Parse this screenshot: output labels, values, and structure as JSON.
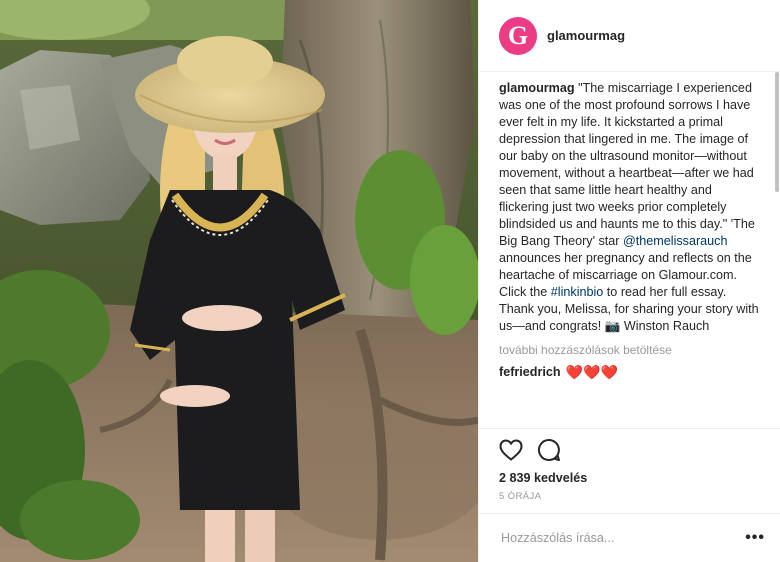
{
  "post": {
    "image_alt": "Pregnant woman in straw hat and black embroidered dress in a forest",
    "author": {
      "avatar_letter": "G",
      "username": "glamourmag"
    },
    "caption": {
      "username": "glamourmag",
      "text_1": "\"The miscarriage I experienced was one of the most profound sorrows I have ever felt in my life. It kickstarted a primal depression that lingered in me. The image of our baby on the ultrasound monitor—without movement, without a heartbeat—after we had seen that same little heart healthy and flickering just two weeks prior completely blindsided us and haunts me to this day.\" 'The Big Bang Theory' star ",
      "mention": "@themelissarauch",
      "text_2": " announces her pregnancy and reflects on the heartache of miscarriage on Glamour.com. Click the ",
      "hashtag": "#linkinbio",
      "text_3": " to read her full essay. Thank you, Melissa, for sharing your story with us—and congrats! 📷 Winston Rauch"
    },
    "load_more_label": "további hozzászólások betöltése",
    "comments": [
      {
        "username": "fefriedrich",
        "text": "❤️❤️❤️"
      }
    ],
    "likes_label": "2 839 kedvelés",
    "time_label": "5 ÓRÁJA",
    "add_comment_placeholder": "Hozzászólás írása...",
    "more_options_label": "•••"
  },
  "colors": {
    "brand": "#ec3c85",
    "link": "#003569",
    "muted": "#999999",
    "heart": "#e0112b"
  },
  "icons": {
    "like": "heart-outline-icon",
    "comment": "speech-bubble-icon"
  }
}
